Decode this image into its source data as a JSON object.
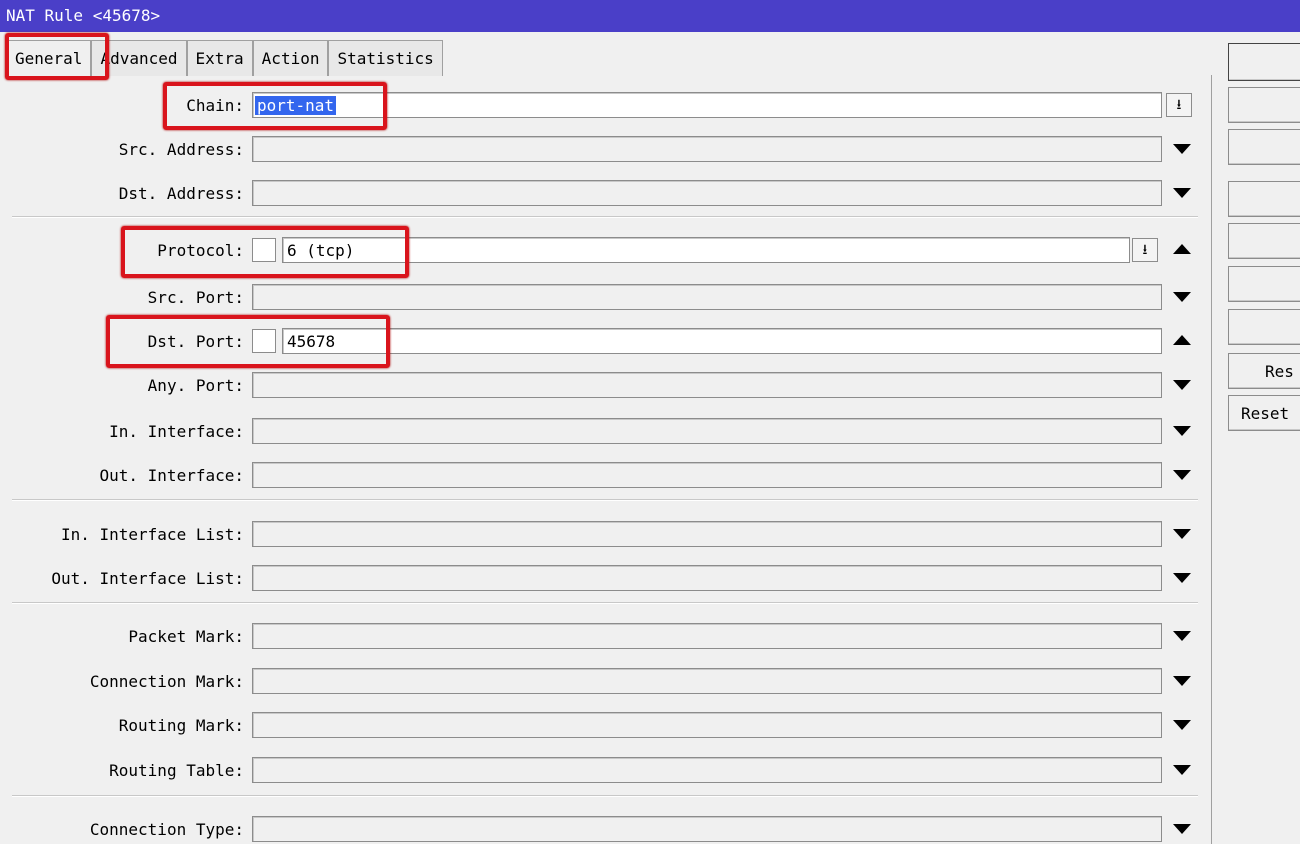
{
  "window": {
    "title": "NAT Rule <45678>"
  },
  "tabs": [
    "General",
    "Advanced",
    "Extra",
    "Action",
    "Statistics"
  ],
  "fields": {
    "chain": {
      "label": "Chain:",
      "value": "port-nat"
    },
    "src_address": {
      "label": "Src. Address:",
      "value": ""
    },
    "dst_address": {
      "label": "Dst. Address:",
      "value": ""
    },
    "protocol": {
      "label": "Protocol:",
      "value": "6 (tcp)"
    },
    "src_port": {
      "label": "Src. Port:",
      "value": ""
    },
    "dst_port": {
      "label": "Dst. Port:",
      "value": "45678"
    },
    "any_port": {
      "label": "Any. Port:",
      "value": ""
    },
    "in_interface": {
      "label": "In. Interface:",
      "value": ""
    },
    "out_interface": {
      "label": "Out. Interface:",
      "value": ""
    },
    "in_interface_list": {
      "label": "In. Interface List:",
      "value": ""
    },
    "out_interface_list": {
      "label": "Out. Interface List:",
      "value": ""
    },
    "packet_mark": {
      "label": "Packet Mark:",
      "value": ""
    },
    "connection_mark": {
      "label": "Connection Mark:",
      "value": ""
    },
    "routing_mark": {
      "label": "Routing Mark:",
      "value": ""
    },
    "routing_table": {
      "label": "Routing Table:",
      "value": ""
    },
    "connection_type": {
      "label": "Connection Type:",
      "value": ""
    }
  },
  "side_buttons": {
    "reset_short": "Res",
    "reset_long": "Reset"
  },
  "colors": {
    "titlebar": "#4a3fc8",
    "highlight": "#d9141c",
    "selection": "#3366ee"
  },
  "icons": {
    "dropdown": "arrow-down-bar-icon",
    "expand": "triangle-down-icon",
    "collapse": "triangle-up-icon"
  }
}
